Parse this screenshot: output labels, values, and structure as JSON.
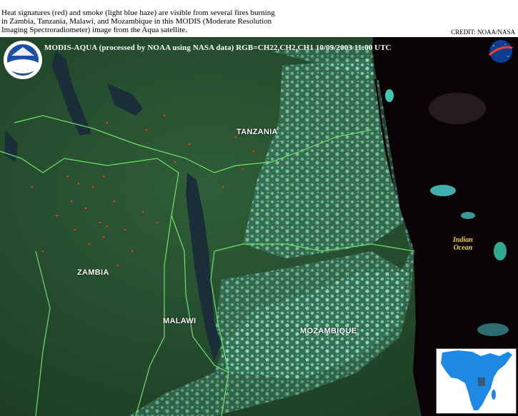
{
  "caption": {
    "line1": "Heat signatures (red) and smoke (light blue haze) are visible from several fires burning",
    "line2": "in Zambia, Tanzania, Malawi, and Mozambique in this MODIS (Moderate Resolution",
    "line3": "Imaging Spectroradiometer) image from the Aqua satellite."
  },
  "credit": "CREDIT: NOAA/NASA",
  "image_header": "MODIS-AQUA  (processed by NOAA using NASA data)  RGB=CH22,CH2,CH1  10/09/2003  11:00 UTC",
  "labels": {
    "tanzania": "TANZANIA",
    "zambia": "ZAMBIA",
    "malawi": "MALAWI",
    "mozambique": "MOZAMBIQUE",
    "ocean_line1": "Indian",
    "ocean_line2": "Ocean"
  },
  "logos": {
    "noaa": "NOAA",
    "nasa": "NASA"
  },
  "colors": {
    "land": "#2d5a36",
    "ocean": "#0a0306",
    "cloud": "#5fe0e0",
    "border": "#6fe06a",
    "fire": "#ff3a10",
    "label_ocean": "#f2d23a",
    "inset_africa": "#1e88e5"
  }
}
